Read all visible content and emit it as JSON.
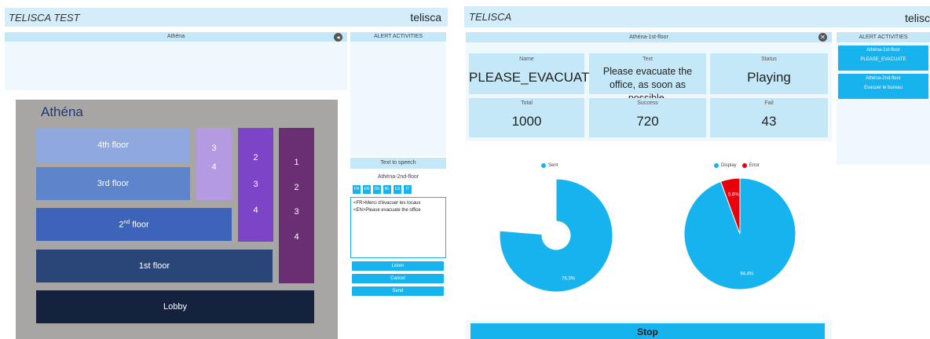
{
  "left": {
    "app_title": "TELISCA TEST",
    "user": "telisca",
    "building_panel_title": "Athéna",
    "alerts_header": "ALERT ACTIVITIES",
    "map": {
      "title": "Athéna",
      "floors": [
        "4th floor",
        "3rd floor",
        "2",
        "floor",
        "nd",
        "1st floor",
        "Lobby"
      ],
      "col_a": [
        "3",
        "4"
      ],
      "col_b": [
        "2",
        "3",
        "4"
      ],
      "col_c": [
        "1",
        "2",
        "3",
        "4"
      ]
    },
    "tts": {
      "header": "Text to speech",
      "target": "Athéna-2nd-floor",
      "languages": [
        "FR",
        "EN",
        "DE",
        "NL",
        "ES",
        "IT"
      ],
      "lines": [
        "<FR>Merci d'évacuer les locaux",
        "<EN>Please evacuate the office"
      ],
      "listen": "Listen",
      "cancel": "Cancel",
      "send": "Send"
    }
  },
  "right": {
    "app_title": "TELISCA",
    "user": "telisc",
    "floor_title": "Athéna-1st-floor",
    "alerts_header": "ALERT ACTIVITIES",
    "stats": {
      "name_label": "Name",
      "name_value": "PLEASE_EVACUATE",
      "text_label": "Text",
      "text_value": "Please evacuate the office, as soon as possible.",
      "status_label": "Status",
      "status_value": "Playing",
      "total_label": "Total",
      "total_value": "1000",
      "success_label": "Success",
      "success_value": "720",
      "fail_label": "Fail",
      "fail_value": "43"
    },
    "alerts": [
      {
        "floor": "Athéna-1st-floor",
        "message": "PLEASE_EVACUATE"
      },
      {
        "floor": "Athéna-2nd-floor",
        "message": "Evacuer le bureau"
      }
    ],
    "stop_label": "Stop",
    "colors": {
      "accent": "#17b3ee",
      "error": "#e8000b",
      "header": "#c5e8f8"
    }
  },
  "chart_data": [
    {
      "type": "pie",
      "variant": "donut",
      "series": [
        {
          "name": "Sent",
          "values": [
            76.3
          ]
        }
      ],
      "categories": [
        "Sent"
      ],
      "data_labels": [
        "76.3%"
      ],
      "legend": "top"
    },
    {
      "type": "pie",
      "categories": [
        "Display",
        "Error"
      ],
      "values": [
        94.4,
        5.6
      ],
      "data_labels": [
        "94.4%",
        "5.6%"
      ],
      "legend": "top"
    }
  ]
}
